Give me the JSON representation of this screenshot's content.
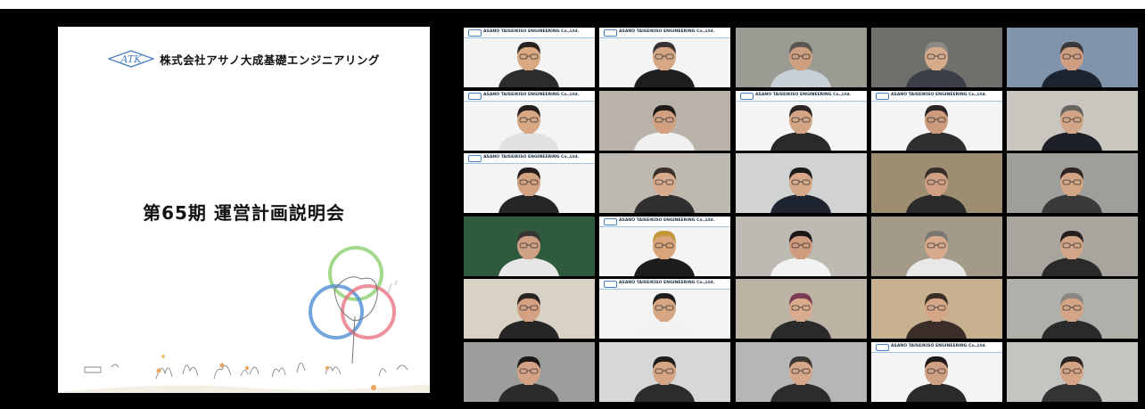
{
  "slide": {
    "logo_text": "ATK",
    "company": "株式会社アサノ大成基礎エンジニアリング",
    "title": "第65期 運営計画説明会"
  },
  "banner_text": "ASANO TAISEIKISO ENGINEERING Co.,Ltd.",
  "colors": {
    "background": "#000000",
    "ring_green": "#8ccf6e",
    "ring_blue": "#4e8fd6",
    "ring_red": "#e86b7a"
  },
  "participants": [
    {
      "bg": "#f4f4f4",
      "banner": true,
      "skin": "#d9a982",
      "hair": "#2a2220",
      "shirt": "#2c2c2c"
    },
    {
      "bg": "#f4f4f4",
      "banner": true,
      "skin": "#d6a784",
      "hair": "#3a3333",
      "shirt": "#1e1e1e"
    },
    {
      "bg": "#9a9c93",
      "banner": false,
      "skin": "#cf9f82",
      "hair": "#5b5652",
      "shirt": "#c8d0d8"
    },
    {
      "bg": "#6f6f6c",
      "banner": false,
      "skin": "#d6ab8c",
      "hair": "#8d8a86",
      "shirt": "#3a3e48"
    },
    {
      "bg": "#8094ab",
      "banner": false,
      "skin": "#cf9d80",
      "hair": "#3a3838",
      "shirt": "#1d2430"
    },
    {
      "bg": "#f4f4f4",
      "banner": true,
      "skin": "#d8a783",
      "hair": "#231e1c",
      "shirt": "#e2e2e2"
    },
    {
      "bg": "#b8b2a8",
      "banner": false,
      "skin": "#d0a080",
      "hair": "#1f1b19",
      "shirt": "#f0f0f0"
    },
    {
      "bg": "#f4f4f4",
      "banner": true,
      "skin": "#d4a584",
      "hair": "#2b2625",
      "shirt": "#2a2a2a"
    },
    {
      "bg": "#f4f4f4",
      "banner": true,
      "skin": "#cc9a7c",
      "hair": "#2a2424",
      "shirt": "#2f2f2f"
    },
    {
      "bg": "#c9c6c0",
      "banner": false,
      "skin": "#d2a588",
      "hair": "#676360",
      "shirt": "#1e2027"
    },
    {
      "bg": "#f4f4f4",
      "banner": true,
      "skin": "#d3a381",
      "hair": "#221d1b",
      "shirt": "#262626"
    },
    {
      "bg": "#bdb9b0",
      "banner": false,
      "skin": "#d8ab8d",
      "hair": "#3b302b",
      "shirt": "#2f2f2f"
    },
    {
      "bg": "#d0d3d2",
      "banner": false,
      "skin": "#d6a887",
      "hair": "#1c1a1a",
      "shirt": "#1f2530"
    },
    {
      "bg": "#9d8e72",
      "banner": false,
      "skin": "#d1a083",
      "hair": "#352f2c",
      "shirt": "#2b2b2b"
    },
    {
      "bg": "#9e9f9b",
      "banner": false,
      "skin": "#d4a585",
      "hair": "#2d2624",
      "shirt": "#3a3a3a"
    },
    {
      "bg": "#2f5a3e",
      "banner": false,
      "skin": "#d0a084",
      "hair": "#3b3636",
      "shirt": "#e7e7e7"
    },
    {
      "bg": "#f4f4f4",
      "banner": true,
      "skin": "#d9a47a",
      "hair": "#c4973a",
      "shirt": "#1d1d1d"
    },
    {
      "bg": "#bdbab4",
      "banner": false,
      "skin": "#cf9c7d",
      "hair": "#1b1818",
      "shirt": "#f2f2f2"
    },
    {
      "bg": "#a49a8a",
      "banner": false,
      "skin": "#d6aa8b",
      "hair": "#7a7672",
      "shirt": "#e8e8e8"
    },
    {
      "bg": "#a7a59d",
      "banner": false,
      "skin": "#d3a588",
      "hair": "#242020",
      "shirt": "#2a2a2a"
    },
    {
      "bg": "#d8d2c5",
      "banner": false,
      "skin": "#d4a282",
      "hair": "#2a2424",
      "shirt": "#262626"
    },
    {
      "bg": "#f4f4f4",
      "banner": true,
      "skin": "#d7a784",
      "hair": "#1f1b1a",
      "shirt": "#f2f2f2"
    },
    {
      "bg": "#bdb3a5",
      "banner": false,
      "skin": "#d8ab8d",
      "hair": "#7a3a55",
      "shirt": "#2a2a2a"
    },
    {
      "bg": "#c7b18e",
      "banner": false,
      "skin": "#d5a787",
      "hair": "#3b2e26",
      "shirt": "#3b2e2a"
    },
    {
      "bg": "#b0b0aa",
      "banner": false,
      "skin": "#d3a587",
      "hair": "#8a8682",
      "shirt": "#2a2a2a"
    },
    {
      "bg": "#9c9e9b",
      "banner": false,
      "skin": "#d4a385",
      "hair": "#1d1a19",
      "shirt": "#2b2b2b"
    },
    {
      "bg": "#d7d7d7",
      "banner": false,
      "skin": "#d5a585",
      "hair": "#1f1c1b",
      "shirt": "#2c2c2c"
    },
    {
      "bg": "#b6b6b6",
      "banner": false,
      "skin": "#d6a788",
      "hair": "#3b3533",
      "shirt": "#2c2c2c"
    },
    {
      "bg": "#f4f4f4",
      "banner": true,
      "skin": "#d0a084",
      "hair": "#1f1b1a",
      "shirt": "#2b2b2b"
    },
    {
      "bg": "#c2c5c0",
      "banner": false,
      "skin": "#d4a485",
      "hair": "#2a2423",
      "shirt": "#333333"
    }
  ]
}
